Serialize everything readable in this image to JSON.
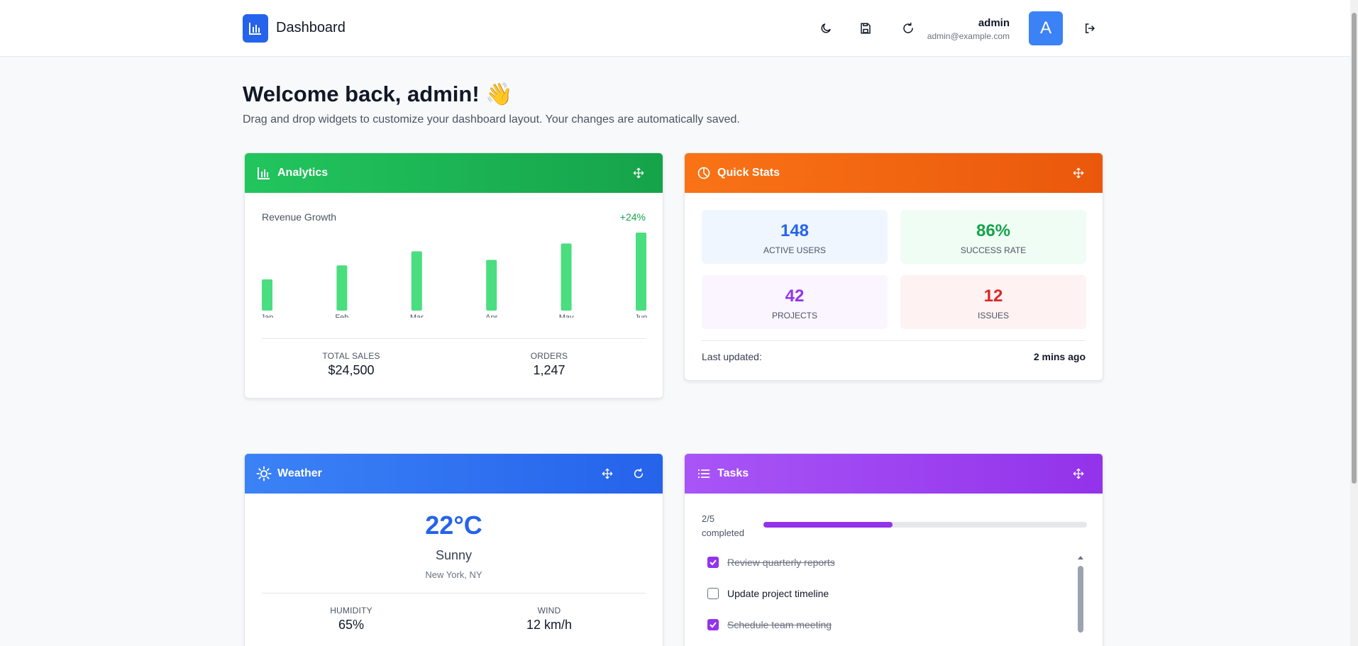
{
  "app": {
    "title": "Dashboard"
  },
  "user": {
    "name": "admin",
    "email": "admin@example.com",
    "initial": "A"
  },
  "welcome": {
    "title": "Welcome back, admin! 👋",
    "subtitle": "Drag and drop widgets to customize your dashboard layout. Your changes are automatically saved."
  },
  "analytics": {
    "title": "Analytics",
    "chart_label": "Revenue Growth",
    "growth": "+24%",
    "total_sales_label": "Total Sales",
    "total_sales": "$24,500",
    "orders_label": "Orders",
    "orders": "1,247"
  },
  "chart_data": {
    "type": "bar",
    "categories": [
      "Jan",
      "Feb",
      "Mar",
      "Apr",
      "May",
      "Jun"
    ],
    "values": [
      40,
      58,
      76,
      65,
      86,
      100
    ],
    "ylim": [
      0,
      100
    ],
    "title": "Revenue Growth",
    "color": "#4ade80"
  },
  "quick_stats": {
    "title": "Quick Stats",
    "tiles": [
      {
        "value": "148",
        "label": "Active Users",
        "color": "#2563eb",
        "bg": "#eff6ff"
      },
      {
        "value": "86%",
        "label": "Success Rate",
        "color": "#16a34a",
        "bg": "#f0fdf4"
      },
      {
        "value": "42",
        "label": "Projects",
        "color": "#9333ea",
        "bg": "#faf5ff"
      },
      {
        "value": "12",
        "label": "Issues",
        "color": "#dc2626",
        "bg": "#fef2f2"
      }
    ],
    "updated_label": "Last updated:",
    "updated_value": "2 mins ago"
  },
  "weather": {
    "title": "Weather",
    "temp": "22°C",
    "condition": "Sunny",
    "location": "New York, NY",
    "humidity_label": "Humidity",
    "humidity": "65%",
    "wind_label": "Wind",
    "wind": "12 km/h"
  },
  "tasks": {
    "title": "Tasks",
    "progress_count": "2/5",
    "progress_word": "completed",
    "progress_fraction": 0.4,
    "items": [
      {
        "label": "Review quarterly reports",
        "done": true
      },
      {
        "label": "Update project timeline",
        "done": false
      },
      {
        "label": "Schedule team meeting",
        "done": true
      }
    ]
  },
  "icons": {
    "theme": "moon-icon",
    "save": "save-icon",
    "refresh": "refresh-icon",
    "logout": "logout-icon",
    "analytics": "bar-chart-icon",
    "stats": "pie-chart-icon",
    "weather": "sun-icon",
    "tasks": "list-icon",
    "move": "move-icon"
  }
}
